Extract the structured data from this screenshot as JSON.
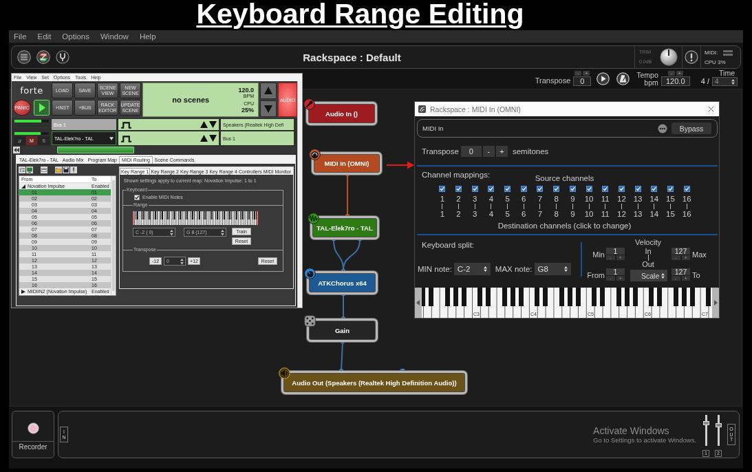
{
  "caption": "Keyboard Range Editing",
  "menu": [
    "File",
    "Edit",
    "Options",
    "Window",
    "Help"
  ],
  "header": {
    "title": "Rackspace : Default",
    "trim_label": "TRIM",
    "trim_value": "0.0dB",
    "midi_label": "MIDI:",
    "cpu": "CPU 3%"
  },
  "transport": {
    "transpose_label": "Transpose",
    "transpose_down": "-",
    "transpose_up": "+",
    "transpose_value": "0",
    "tempo_label": "Tempo",
    "bpm_label": "bpm",
    "tempo_down": "-",
    "tempo_up": "+",
    "tempo_value": "120.0",
    "time_numerator": "4 /",
    "time_label": "Time",
    "time_denominator": "4"
  },
  "forte": {
    "menu": [
      "File",
      "View",
      "Set",
      "Options",
      "Tools",
      "Help"
    ],
    "logo": "forte",
    "top_buttons": [
      "LOAD",
      "SAVE",
      "SCENE VIEW",
      "NEW SCENE"
    ],
    "panic": "PANIC",
    "bottom_buttons": [
      "+INST",
      "+BUS",
      "RACK EDITOR",
      "UPDATE SCENE"
    ],
    "display": {
      "scene": "no scenes",
      "bpm": "120.0",
      "bpm_unit": "BPM",
      "cpu_label": "CPU",
      "cpu": "25%"
    },
    "audio": "AUDIO",
    "strips": [
      {
        "kind": "bus",
        "name": "Bus 1",
        "output": "Speakers (Realtek High Defi",
        "level": 0.78
      },
      {
        "kind": "instrument",
        "name": "TAL-Elek?ro - TAL",
        "output": "Bus 1",
        "level": 0.75,
        "buttons": [
          "♫",
          "M",
          "S"
        ]
      }
    ],
    "tabs": [
      {
        "label": "TAL-Elek7ro - TAL",
        "selected": false
      },
      {
        "label": "Audio Mix",
        "selected": false
      },
      {
        "label": "Program Map",
        "selected": false
      },
      {
        "label": "MIDI Routing",
        "selected": true
      },
      {
        "label": "Scene Commands",
        "selected": false
      }
    ],
    "routing": {
      "columns": [
        "From",
        "To"
      ],
      "devices": [
        {
          "name": "Novation Impulse",
          "status": "Enabled",
          "expanded": true,
          "children": [
            {
              "from": "01",
              "to": "01",
              "selected": true
            },
            {
              "from": "02",
              "to": "02",
              "selected": false
            },
            {
              "from": "03",
              "to": "03",
              "selected": false
            },
            {
              "from": "04",
              "to": "04",
              "selected": false
            },
            {
              "from": "05",
              "to": "05",
              "selected": false
            },
            {
              "from": "06",
              "to": "06",
              "selected": false
            },
            {
              "from": "07",
              "to": "07",
              "selected": false
            },
            {
              "from": "08",
              "to": "08",
              "selected": false
            },
            {
              "from": "09",
              "to": "09",
              "selected": false
            },
            {
              "from": "10",
              "to": "10",
              "selected": false
            },
            {
              "from": "11",
              "to": "11",
              "selected": false
            },
            {
              "from": "12",
              "to": "12",
              "selected": false
            },
            {
              "from": "13",
              "to": "13",
              "selected": false
            },
            {
              "from": "14",
              "to": "14",
              "selected": false
            },
            {
              "from": "15",
              "to": "15",
              "selected": false
            },
            {
              "from": "16",
              "to": "16",
              "selected": false
            }
          ]
        },
        {
          "name": "MIDIIN2 (Novation Impulse)",
          "status": "Enabled",
          "expanded": false
        }
      ]
    },
    "key_tabs": [
      {
        "label": "Key Range 1",
        "selected": true
      },
      {
        "label": "Key Range 2",
        "selected": false
      },
      {
        "label": "Key Range 3",
        "selected": false
      },
      {
        "label": "Key Range 4",
        "selected": false
      },
      {
        "label": "Controllers",
        "selected": false
      },
      {
        "label": "MIDI Monitor",
        "selected": false
      }
    ],
    "note": "Shown settings apply to current map: Novation Impulse: 1 to 1",
    "keyboard_group": "Keyboard",
    "enable_notes": {
      "label": "Enable MIDI Notes",
      "checked": true
    },
    "range_group": "Range",
    "range_low": "C -2 ( 0)",
    "range_high": "G 8 (127)",
    "train": "Train",
    "range_reset": "Reset",
    "transpose_group": "Transpose",
    "transpose_down": "-12",
    "transpose_value": "0",
    "transpose_up": "+12",
    "transpose_reset": "Reset"
  },
  "nodes": [
    {
      "kind": "audio_in",
      "label": "Audio In ()",
      "color": "#9e1b1f"
    },
    {
      "kind": "midi_in",
      "label": "MIDI In (OMNI)",
      "color": "#b44a1f"
    },
    {
      "kind": "synth",
      "label": "TAL-Elek7ro - TAL",
      "color": "#2e7a14"
    },
    {
      "kind": "effect",
      "label": "ATKChorus x64",
      "color": "#1d5a94"
    },
    {
      "kind": "gain",
      "label": "Gain",
      "color": "#252525"
    },
    {
      "kind": "audio_out",
      "label": "Audio Out (Speakers (Realtek High Definition Audio))",
      "color": "#6a5218"
    }
  ],
  "midi_dialog": {
    "title": "Rackspace : MIDI In (OMNI)",
    "name": "MIDI In",
    "bypass": "Bypass",
    "transpose_label": "Transpose",
    "transpose_value": "0",
    "transpose_down": "-",
    "transpose_up": "+",
    "transpose_units": "semitones",
    "mappings_label": "Channel mappings:",
    "source_label": "Source channels",
    "channels": [
      {
        "source": "1",
        "destination": "1",
        "checked": true
      },
      {
        "source": "2",
        "destination": "2",
        "checked": true
      },
      {
        "source": "3",
        "destination": "3",
        "checked": true
      },
      {
        "source": "4",
        "destination": "4",
        "checked": true
      },
      {
        "source": "5",
        "destination": "5",
        "checked": true
      },
      {
        "source": "6",
        "destination": "6",
        "checked": true
      },
      {
        "source": "7",
        "destination": "7",
        "checked": true
      },
      {
        "source": "8",
        "destination": "8",
        "checked": true
      },
      {
        "source": "9",
        "destination": "9",
        "checked": true
      },
      {
        "source": "10",
        "destination": "10",
        "checked": true
      },
      {
        "source": "11",
        "destination": "11",
        "checked": true
      },
      {
        "source": "12",
        "destination": "12",
        "checked": true
      },
      {
        "source": "13",
        "destination": "13",
        "checked": true
      },
      {
        "source": "14",
        "destination": "14",
        "checked": true
      },
      {
        "source": "15",
        "destination": "15",
        "checked": true
      },
      {
        "source": "16",
        "destination": "16",
        "checked": true
      }
    ],
    "destination_label": "Destination channels (click to change)",
    "split_label": "Keyboard split:",
    "min_note_label": "MIN note:",
    "min_note": "C-2",
    "max_note_label": "MAX note:",
    "max_note": "G8",
    "velocity": {
      "title": "Velocity",
      "in_label": "In",
      "out_label": "Out",
      "mode": "Scale",
      "fields": [
        {
          "label": "Min",
          "value": "1",
          "down": "-",
          "up": "+"
        },
        {
          "label": "Max",
          "value": "127",
          "down": "-",
          "up": "+"
        },
        {
          "label": "From",
          "value": "1",
          "down": "-",
          "up": "+"
        },
        {
          "label": "To",
          "value": "127",
          "down": "-",
          "up": "+"
        }
      ]
    },
    "keyboard_labels": [
      "C3",
      "C4",
      "C5",
      "C6",
      "C7"
    ]
  },
  "bottom": {
    "recorder": "Recorder",
    "in_tag": "IN",
    "notice_title": "Activate Windows",
    "notice_text": "Go to Settings to activate Windows.",
    "faders": [
      {
        "label": "1",
        "level": 0.76
      },
      {
        "label": "2",
        "level": 0.69
      }
    ],
    "out_tag": "OUT"
  }
}
